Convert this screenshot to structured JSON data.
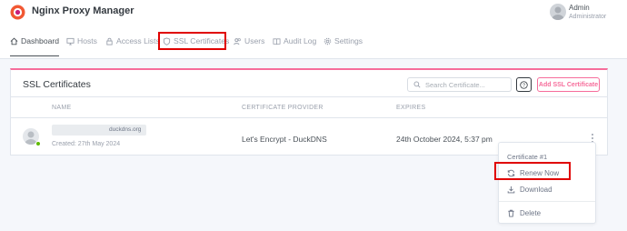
{
  "header": {
    "app_title": "Nginx Proxy Manager",
    "user_name": "Admin",
    "user_role": "Administrator"
  },
  "nav": {
    "items": [
      {
        "label": "Dashboard",
        "icon": "home-icon",
        "active": true
      },
      {
        "label": "Hosts",
        "icon": "monitor-icon"
      },
      {
        "label": "Access Lists",
        "icon": "lock-icon"
      },
      {
        "label": "SSL Certificates",
        "icon": "shield-icon",
        "highlighted": true
      },
      {
        "label": "Users",
        "icon": "users-icon"
      },
      {
        "label": "Audit Log",
        "icon": "book-icon"
      },
      {
        "label": "Settings",
        "icon": "gear-icon"
      }
    ]
  },
  "card": {
    "title": "SSL Certificates",
    "search_placeholder": "Search Certificate...",
    "help_label": "?",
    "add_button": "Add SSL Certificate",
    "columns": [
      "NAME",
      "CERTIFICATE PROVIDER",
      "EXPIRES"
    ],
    "rows": [
      {
        "domain": "duckdns.org",
        "created": "Created: 27th May 2024",
        "provider": "Let's Encrypt - DuckDNS",
        "expires": "24th October 2024, 5:37 pm",
        "status_color": "#5eba00"
      }
    ]
  },
  "dropdown": {
    "header": "Certificate #1",
    "items": [
      {
        "label": "Renew Now",
        "icon": "refresh-icon",
        "highlighted": true
      },
      {
        "label": "Download",
        "icon": "download-icon"
      },
      {
        "label": "Delete",
        "icon": "trash-icon"
      }
    ]
  },
  "colors": {
    "accent_pink": "#f66d9b",
    "highlight_red": "#e00000",
    "logo_orange": "#f15833"
  }
}
